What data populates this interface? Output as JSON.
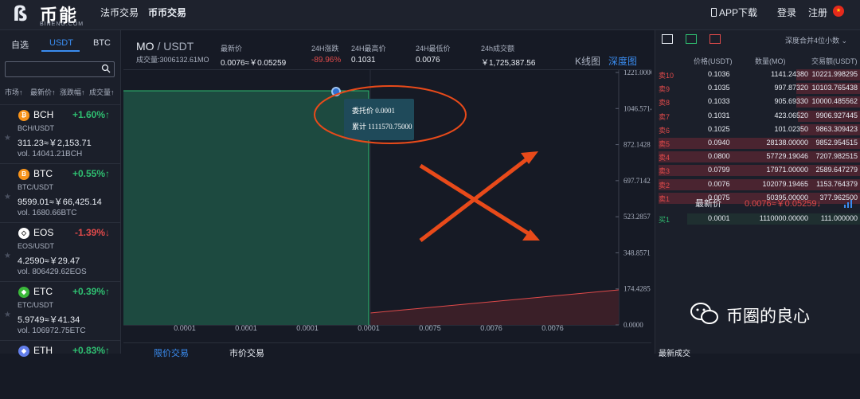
{
  "brand": {
    "logo_mark": "ß",
    "name": "币能",
    "domain": "BINENG.COM"
  },
  "nav": {
    "fiat": "法币交易",
    "coin": "币币交易"
  },
  "nav_right": {
    "app": "APP下载",
    "login": "登录",
    "register": "注册"
  },
  "sidebar": {
    "tabs": [
      "自选",
      "USDT",
      "BTC"
    ],
    "search_placeholder": "",
    "columns": [
      "市场↑",
      "最新价↑",
      "涨跌幅↑",
      "成交量↑"
    ],
    "coins": [
      {
        "name": "BCH",
        "change": "+1.60%↑",
        "pair": "BCH/USDT",
        "price": "311.23≈￥2,153.71",
        "vol": "vol. 14041.21BCH",
        "color": "#f7931a",
        "dir": "up"
      },
      {
        "name": "BTC",
        "change": "+0.55%↑",
        "pair": "BTC/USDT",
        "price": "9599.01≈￥66,425.14",
        "vol": "vol. 1680.66BTC",
        "color": "#f7931a",
        "dir": "up"
      },
      {
        "name": "EOS",
        "change": "-1.39%↓",
        "pair": "EOS/USDT",
        "price": "4.2590≈￥29.47",
        "vol": "vol. 806429.62EOS",
        "color": "#222222",
        "dir": "dn"
      },
      {
        "name": "ETC",
        "change": "+0.39%↑",
        "pair": "ETC/USDT",
        "price": "5.9749≈￥41.34",
        "vol": "vol. 106972.75ETC",
        "color": "#3ab83a",
        "dir": "up"
      },
      {
        "name": "ETH",
        "change": "+0.83%↑",
        "pair": "",
        "price": "",
        "vol": "",
        "color": "#627eea",
        "dir": "up"
      }
    ]
  },
  "ticker": {
    "base": "MO",
    "quote": "USDT",
    "volume": "成交量:3006132.61MO",
    "stats": [
      {
        "label": "最新价",
        "value": "0.0076≈￥0.05259",
        "dir": ""
      },
      {
        "label": "24H涨跌",
        "value": "-89.96%",
        "dir": "dn"
      },
      {
        "label": "24H最高价",
        "value": "0.1031",
        "dir": ""
      },
      {
        "label": "24H最低价",
        "value": "0.0076",
        "dir": ""
      },
      {
        "label": "24h成交额",
        "value": "￥1,725,387.56",
        "dir": ""
      }
    ],
    "views": [
      "K线图",
      "深度图"
    ]
  },
  "depth_chart": {
    "y_ticks": [
      "1221.0000",
      "1046.5714",
      "872.1428",
      "697.7142",
      "523.2857",
      "348.8571",
      "174.4285",
      "0.0000"
    ],
    "x_ticks": [
      "0.0001",
      "0.0001",
      "0.0001",
      "0.0001",
      "0.0075",
      "0.0076",
      "0.0076"
    ],
    "tooltip": {
      "price_label": "委托价",
      "price": "0.0001",
      "total_label": "累计",
      "total": "1111570.75000"
    }
  },
  "bottom_tabs": [
    "限价交易",
    "市价交易"
  ],
  "book": {
    "depth_select": "深度合并4位小数",
    "headers": [
      "价格(USDT)",
      "数量(MO)",
      "交易额(USDT)"
    ],
    "asks": [
      {
        "label": "卖10",
        "price": "0.1036",
        "amount": "1141.24380",
        "total": "10221.998295",
        "fill": 0.32
      },
      {
        "label": "卖9",
        "price": "0.1035",
        "amount": "997.87320",
        "total": "10103.765438",
        "fill": 0.32
      },
      {
        "label": "卖8",
        "price": "0.1033",
        "amount": "905.69330",
        "total": "10000.485562",
        "fill": 0.32
      },
      {
        "label": "卖7",
        "price": "0.1031",
        "amount": "423.06520",
        "total": "9906.927445",
        "fill": 0.31
      },
      {
        "label": "卖6",
        "price": "0.1025",
        "amount": "101.02350",
        "total": "9863.309423",
        "fill": 0.3
      },
      {
        "label": "卖5",
        "price": "0.0940",
        "amount": "28138.00000",
        "total": "9852.954515",
        "fill": 1.0
      },
      {
        "label": "卖4",
        "price": "0.0800",
        "amount": "57729.19046",
        "total": "7207.982515",
        "fill": 1.0
      },
      {
        "label": "卖3",
        "price": "0.0799",
        "amount": "17971.00000",
        "total": "2589.647279",
        "fill": 1.0
      },
      {
        "label": "卖2",
        "price": "0.0076",
        "amount": "102079.19465",
        "total": "1153.764379",
        "fill": 1.0
      },
      {
        "label": "卖1",
        "price": "0.0075",
        "amount": "50395.00000",
        "total": "377.962500",
        "fill": 1.0
      }
    ],
    "last_label": "最新价",
    "last_value": "0.0076≈￥0.05259↓",
    "bids": [
      {
        "label": "买1",
        "price": "0.0001",
        "amount": "1110000.00000",
        "total": "111.000000"
      }
    ],
    "latest_trades": "最新成交"
  },
  "watermark": "币圈的良心"
}
